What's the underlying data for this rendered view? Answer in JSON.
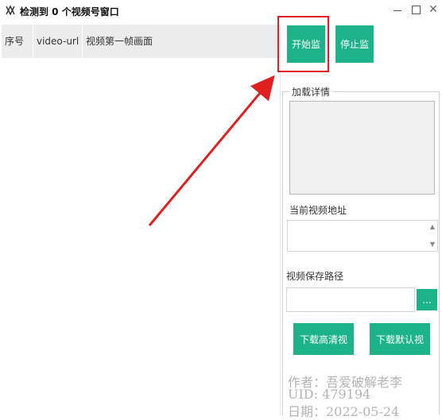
{
  "window": {
    "title": "检测到 0 个视频号窗口",
    "icon": "app-logo-icon",
    "controls": [
      "minimize-icon",
      "maximize-icon",
      "close-icon"
    ]
  },
  "table": {
    "columns": [
      "序号",
      "video-url",
      "视频第一帧画面"
    ],
    "rows": []
  },
  "controls": {
    "start_label": "开始监控",
    "stop_label": "停止监控"
  },
  "details": {
    "group_title": "加载详情",
    "address_label": "当前视频地址",
    "address_value": "",
    "save_path_label": "视频保存路径",
    "save_path_value": "",
    "browse_label": "...",
    "download_hd_label": "下载高清视频",
    "download_default_label": "下载默认视频"
  },
  "watermark": {
    "line1": "作者：吾爱破解老李",
    "line2": "UID: 479194",
    "line3": "日期：2022-05-24"
  },
  "colors": {
    "accent": "#1cb38b",
    "highlight": "#e02020",
    "header_bg": "#ececec"
  }
}
